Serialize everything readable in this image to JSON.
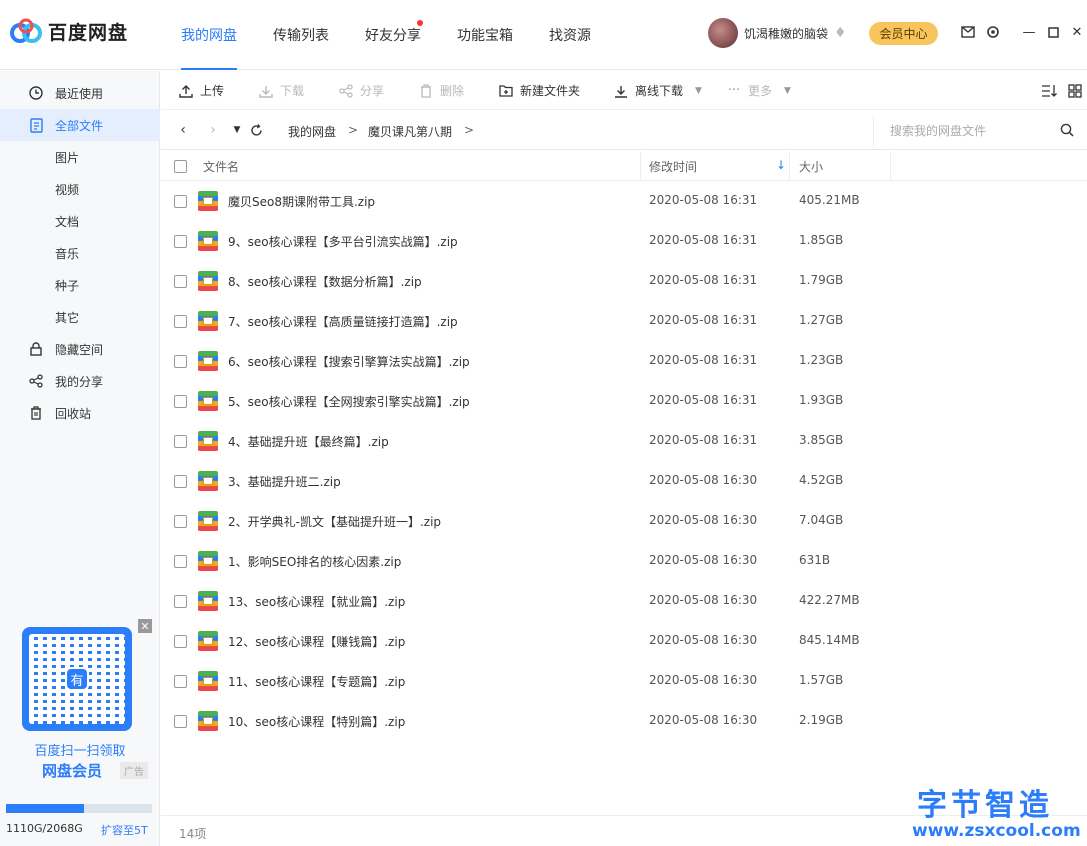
{
  "app": {
    "title": "百度网盘"
  },
  "nav": {
    "tabs": [
      {
        "label": "我的网盘",
        "active": true
      },
      {
        "label": "传输列表"
      },
      {
        "label": "好友分享",
        "dot": true
      },
      {
        "label": "功能宝箱"
      },
      {
        "label": "找资源"
      }
    ]
  },
  "user": {
    "name": "饥渴稚嫩的脑袋",
    "vip_label": "会员中心"
  },
  "sidebar": {
    "items": [
      {
        "label": "最近使用",
        "icon": "clock-icon"
      },
      {
        "label": "全部文件",
        "icon": "file-list-icon",
        "active": true
      },
      {
        "label": "图片"
      },
      {
        "label": "视频"
      },
      {
        "label": "文档"
      },
      {
        "label": "音乐"
      },
      {
        "label": "种子"
      },
      {
        "label": "其它"
      },
      {
        "label": "隐藏空间",
        "icon": "lock-icon"
      },
      {
        "label": "我的分享",
        "icon": "share-icon"
      },
      {
        "label": "回收站",
        "icon": "trash-icon"
      }
    ],
    "ad": {
      "line1": "百度扫一扫领取",
      "line2": "网盘会员",
      "tag": "广告",
      "qr_center": "有"
    },
    "quota": {
      "used": "1110G",
      "total": "2068G",
      "text": "1110G/2068G",
      "fraction": 0.537,
      "expand_label": "扩容至5T"
    }
  },
  "toolbar": {
    "upload": "上传",
    "download": "下载",
    "share": "分享",
    "delete": "删除",
    "new_folder": "新建文件夹",
    "offline_download": "离线下载",
    "more": "更多"
  },
  "address": {
    "crumbs": [
      "我的网盘",
      "魔贝课凡第八期"
    ],
    "search_placeholder": "搜索我的网盘文件"
  },
  "table": {
    "headers": {
      "name": "文件名",
      "modified": "修改时间",
      "size": "大小"
    },
    "rows": [
      {
        "name": "魔贝Seo8期课附带工具.zip",
        "time": "2020-05-08 16:31",
        "size": "405.21MB"
      },
      {
        "name": "9、seo核心课程【多平台引流实战篇】.zip",
        "time": "2020-05-08 16:31",
        "size": "1.85GB"
      },
      {
        "name": "8、seo核心课程【数据分析篇】.zip",
        "time": "2020-05-08 16:31",
        "size": "1.79GB"
      },
      {
        "name": "7、seo核心课程【高质量链接打造篇】.zip",
        "time": "2020-05-08 16:31",
        "size": "1.27GB"
      },
      {
        "name": "6、seo核心课程【搜索引擎算法实战篇】.zip",
        "time": "2020-05-08 16:31",
        "size": "1.23GB"
      },
      {
        "name": "5、seo核心课程【全网搜索引擎实战篇】.zip",
        "time": "2020-05-08 16:31",
        "size": "1.93GB"
      },
      {
        "name": "4、基础提升班【最终篇】.zip",
        "time": "2020-05-08 16:31",
        "size": "3.85GB"
      },
      {
        "name": "3、基础提升班二.zip",
        "time": "2020-05-08 16:30",
        "size": "4.52GB"
      },
      {
        "name": "2、开学典礼-凯文【基础提升班一】.zip",
        "time": "2020-05-08 16:30",
        "size": "7.04GB"
      },
      {
        "name": "1、影响SEO排名的核心因素.zip",
        "time": "2020-05-08 16:30",
        "size": "631B"
      },
      {
        "name": "13、seo核心课程【就业篇】.zip",
        "time": "2020-05-08 16:30",
        "size": "422.27MB"
      },
      {
        "name": "12、seo核心课程【赚钱篇】.zip",
        "time": "2020-05-08 16:30",
        "size": "845.14MB"
      },
      {
        "name": "11、seo核心课程【专题篇】.zip",
        "time": "2020-05-08 16:30",
        "size": "1.57GB"
      },
      {
        "name": "10、seo核心课程【特别篇】.zip",
        "time": "2020-05-08 16:30",
        "size": "2.19GB"
      }
    ],
    "count": "14项"
  },
  "watermark": {
    "title": "字节智造",
    "url": "www.zsxcool.com"
  },
  "colors": {
    "accent": "#2c7dfa",
    "vip": "#f8c55c"
  }
}
